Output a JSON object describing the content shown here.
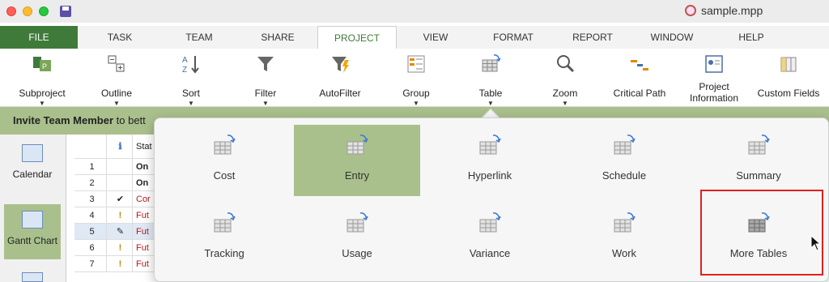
{
  "window": {
    "title": "sample.mpp"
  },
  "tabs": [
    "FILE",
    "TASK",
    "TEAM",
    "SHARE",
    "PROJECT",
    "VIEW",
    "FORMAT",
    "REPORT",
    "WINDOW",
    "HELP"
  ],
  "active_tab": "PROJECT",
  "ribbon": {
    "subproject": "Subproject",
    "outline": "Outline",
    "sort": "Sort",
    "filter": "Filter",
    "autofilter": "AutoFilter",
    "group": "Group",
    "table": "Table",
    "zoom": "Zoom",
    "critical_path": "Critical Path",
    "project_info_line1": "Project",
    "project_info_line2": "Information",
    "custom_fields": "Custom Fields"
  },
  "invite": {
    "bold": "Invite Team Member",
    "rest": " to bett"
  },
  "viewbar": {
    "calendar": "Calendar",
    "gantt": "Gantt Chart"
  },
  "sheet": {
    "header_status": "Stat",
    "rows": [
      {
        "num": "1",
        "name": "On",
        "style": "bold"
      },
      {
        "num": "2",
        "name": "On",
        "style": "bold"
      },
      {
        "num": "3",
        "name": "Cor",
        "style": "red"
      },
      {
        "num": "4",
        "name": "Fut",
        "style": "red"
      },
      {
        "num": "5",
        "name": "Fut",
        "style": "red"
      },
      {
        "num": "6",
        "name": "Fut",
        "style": "red"
      },
      {
        "num": "7",
        "name": "Fut",
        "style": "red"
      }
    ]
  },
  "table_menu": {
    "cost": "Cost",
    "entry": "Entry",
    "hyperlink": "Hyperlink",
    "schedule": "Schedule",
    "summary": "Summary",
    "tracking": "Tracking",
    "usage": "Usage",
    "variance": "Variance",
    "work": "Work",
    "more_tables": "More Tables",
    "selected": "Entry"
  },
  "colors": {
    "accent_green": "#3f7a3a",
    "selection_green": "#a9c08c",
    "highlight_red": "#e02020"
  }
}
